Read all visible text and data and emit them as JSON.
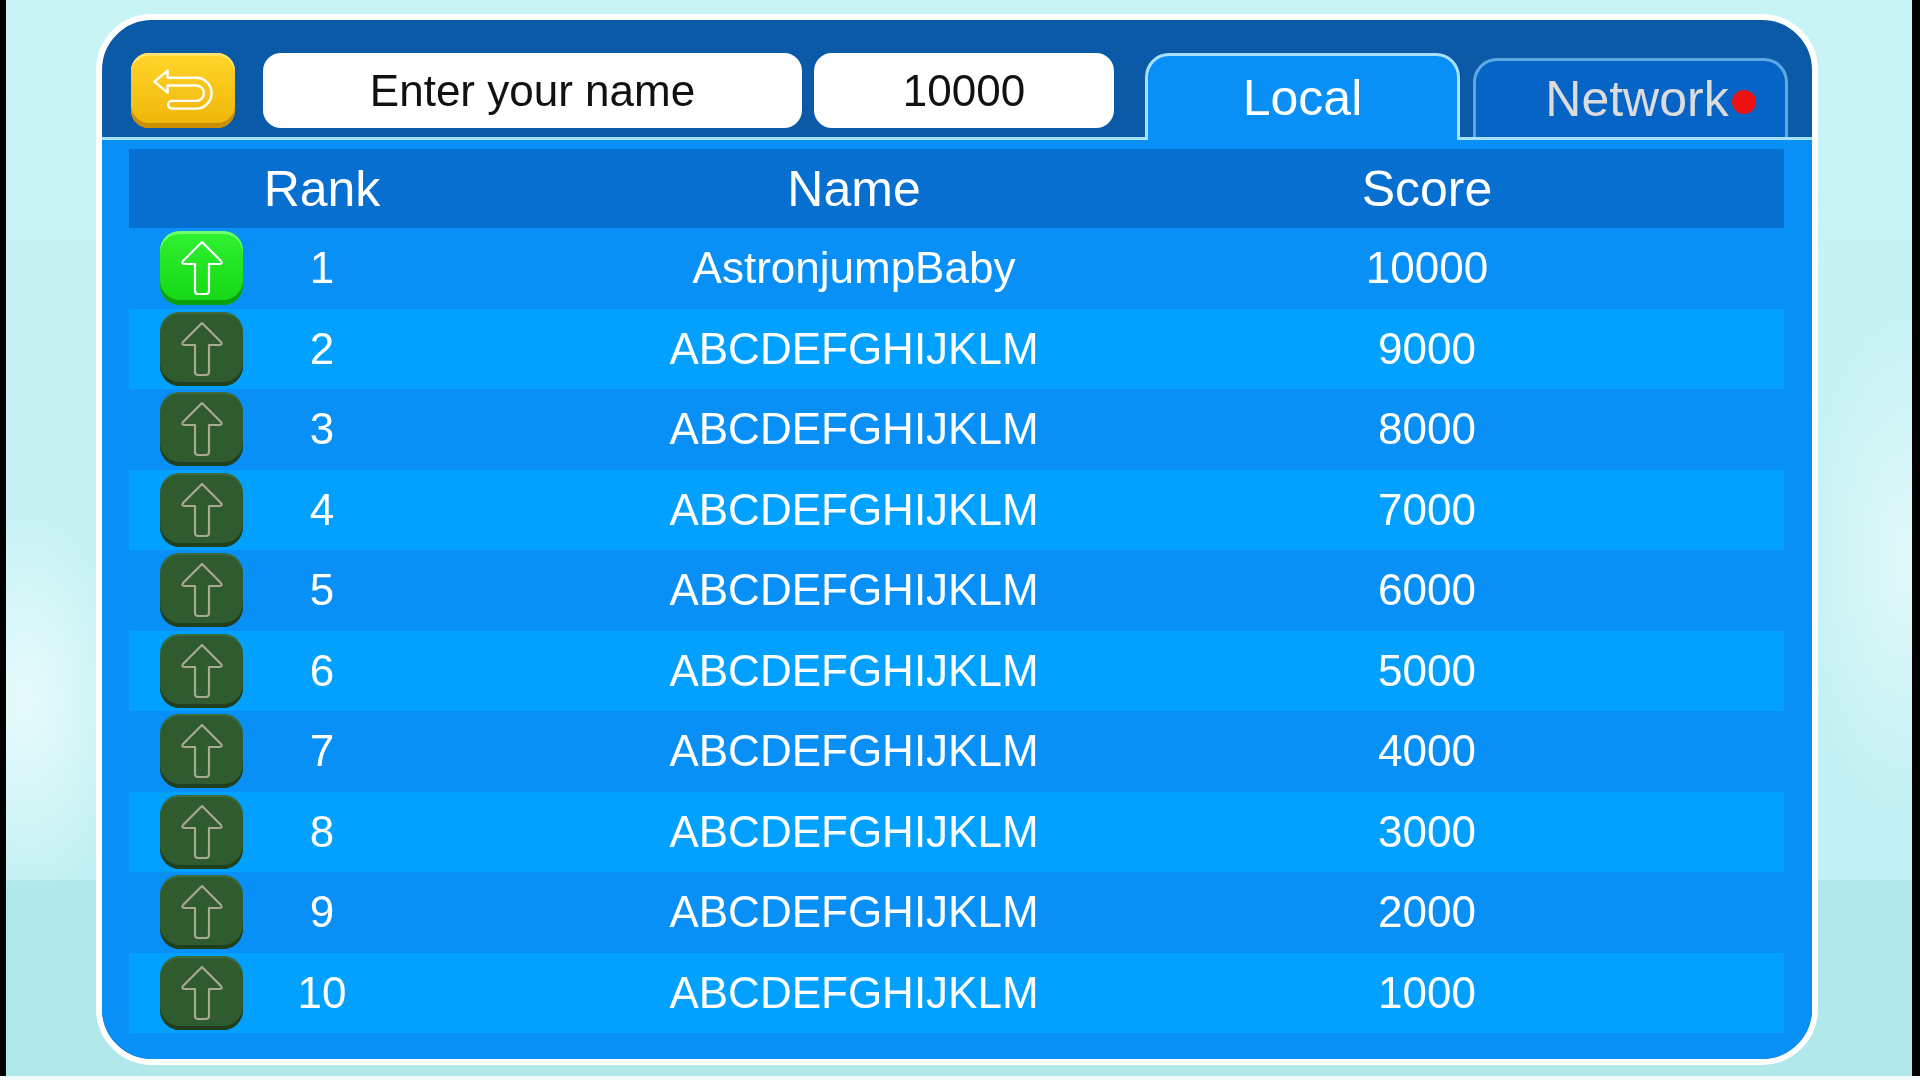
{
  "name_field": {
    "placeholder": "Enter your name"
  },
  "score_display": "10000",
  "tabs": [
    {
      "label": "Local",
      "selected": true,
      "alert": false
    },
    {
      "label": "Network",
      "selected": false,
      "alert": true
    }
  ],
  "table": {
    "columns": [
      "Rank",
      "Name",
      "Score"
    ],
    "rows": [
      {
        "rank": "1",
        "name": "AstronjumpBaby",
        "score": "10000",
        "active": true
      },
      {
        "rank": "2",
        "name": "ABCDEFGHIJKLM",
        "score": "9000",
        "active": false
      },
      {
        "rank": "3",
        "name": "ABCDEFGHIJKLM",
        "score": "8000",
        "active": false
      },
      {
        "rank": "4",
        "name": "ABCDEFGHIJKLM",
        "score": "7000",
        "active": false
      },
      {
        "rank": "5",
        "name": "ABCDEFGHIJKLM",
        "score": "6000",
        "active": false
      },
      {
        "rank": "6",
        "name": "ABCDEFGHIJKLM",
        "score": "5000",
        "active": false
      },
      {
        "rank": "7",
        "name": "ABCDEFGHIJKLM",
        "score": "4000",
        "active": false
      },
      {
        "rank": "8",
        "name": "ABCDEFGHIJKLM",
        "score": "3000",
        "active": false
      },
      {
        "rank": "9",
        "name": "ABCDEFGHIJKLM",
        "score": "2000",
        "active": false
      },
      {
        "rank": "10",
        "name": "ABCDEFGHIJKLM",
        "score": "1000",
        "active": false
      }
    ]
  }
}
